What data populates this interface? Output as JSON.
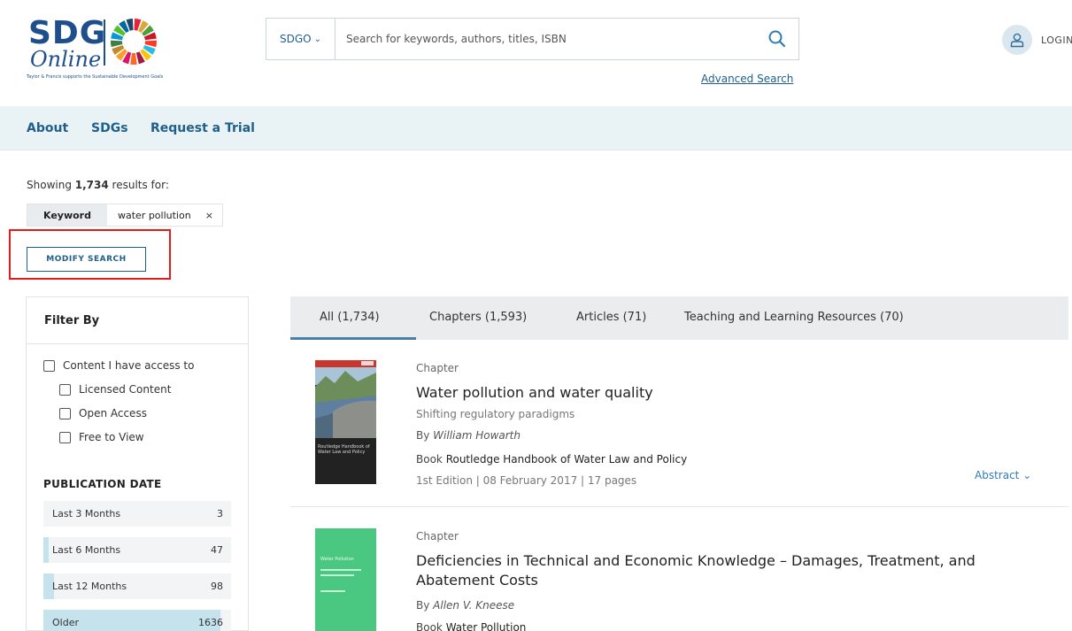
{
  "header": {
    "logo": {
      "sdg": "SDG",
      "online": "Online",
      "tagline": "Taylor & Francis supports the Sustainable Development Goals"
    },
    "search": {
      "scope": "SDGO",
      "placeholder": "Search for keywords, authors, titles, ISBN",
      "value": ""
    },
    "advanced_search": "Advanced Search",
    "login": "LOGIN"
  },
  "nav": {
    "items": [
      {
        "label": "About"
      },
      {
        "label": "SDGs"
      },
      {
        "label": "Request a Trial"
      }
    ]
  },
  "results_summary": {
    "showing_prefix": "Showing ",
    "count": "1,734",
    "showing_suffix": " results for:",
    "chip": {
      "key": "Keyword",
      "value": "water pollution",
      "remove": "×"
    },
    "modify_button": "MODIFY SEARCH"
  },
  "filter": {
    "title": "Filter By",
    "access": {
      "label": "Content I have access to",
      "options": [
        {
          "label": "Licensed Content",
          "checked": false
        },
        {
          "label": "Open Access",
          "checked": false
        },
        {
          "label": "Free to View",
          "checked": false
        }
      ]
    },
    "publication_date": {
      "title": "PUBLICATION DATE",
      "ranges": [
        {
          "label": "Last 3 Months",
          "count": "3",
          "share": 0.0
        },
        {
          "label": "Last 6 Months",
          "count": "47",
          "share": 0.027
        },
        {
          "label": "Last 12 Months",
          "count": "98",
          "share": 0.057
        },
        {
          "label": "Older",
          "count": "1636",
          "share": 0.944
        }
      ]
    }
  },
  "tabs": [
    {
      "label": "All (1,734)",
      "active": true
    },
    {
      "label": "Chapters (1,593)",
      "active": false
    },
    {
      "label": "Articles (71)",
      "active": false
    },
    {
      "label": "Teaching and Learning Resources (70)",
      "active": false
    }
  ],
  "results": [
    {
      "type": "Chapter",
      "title": "Water pollution and water quality",
      "subtitle": "Shifting regulatory paradigms",
      "by_prefix": "By ",
      "author": "William Howarth",
      "book_prefix": "Book ",
      "book_title": "Routledge Handbook of Water Law and Policy",
      "meta": "1st Edition | 08 February 2017 | 17 pages",
      "abstract": "Abstract",
      "cover_text": "Routledge Handbook of Water Law and Policy"
    },
    {
      "type": "Chapter",
      "title": "Deficiencies in Technical and Economic Knowledge – Damages, Treatment, and Abatement Costs",
      "by_prefix": "By ",
      "author": "Allen V. Kneese",
      "book_prefix": "Book ",
      "book_title": "Water Pollution",
      "cover_text": "Water Pollution"
    }
  ],
  "colors": {
    "brand_blue": "#1e4e8c",
    "link_blue": "#1f5f8b",
    "nav_bg": "#e9f2f5",
    "highlight_red": "#e21b1b",
    "date_fill": "#c4e3ed"
  }
}
